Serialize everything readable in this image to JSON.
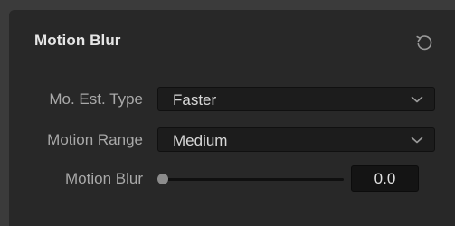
{
  "panel": {
    "title": "Motion Blur",
    "reset_icon": "reset-icon"
  },
  "rows": [
    {
      "label": "Mo. Est. Type",
      "control": "select",
      "value": "Faster"
    },
    {
      "label": "Motion Range",
      "control": "select",
      "value": "Medium"
    },
    {
      "label": "Motion Blur",
      "control": "slider",
      "value": "0.0",
      "slider_fraction": 0.0
    }
  ],
  "icons": {
    "dropdown": "chevron-down-icon",
    "reset": "reset-icon"
  },
  "colors": {
    "background": "#3b3b3b",
    "panel": "#282828",
    "field": "#1c1c1c",
    "label": "#a9a9a9",
    "value": "#d8d8d8"
  }
}
